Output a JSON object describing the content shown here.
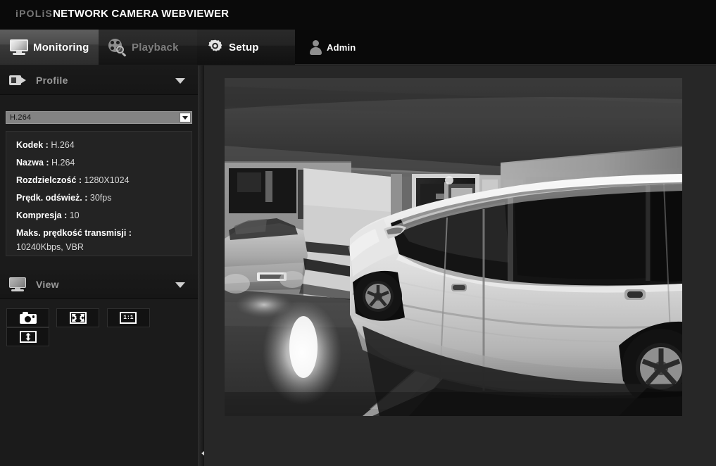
{
  "header": {
    "brand_prefix": "iPOLiS",
    "brand_title": "NETWORK CAMERA WEBVIEWER"
  },
  "tabs": [
    {
      "id": "monitoring",
      "label": "Monitoring",
      "icon": "monitor-icon",
      "active": true
    },
    {
      "id": "playback",
      "label": "Playback",
      "icon": "film-reel-search-icon",
      "active": false
    },
    {
      "id": "setup",
      "label": "Setup",
      "icon": "gear-icon",
      "active": false
    }
  ],
  "user": {
    "label": "Admin",
    "icon": "person-icon"
  },
  "sidebar": {
    "profile_panel": {
      "title": "Profile",
      "icon": "camcorder-icon",
      "chevron": "chevron-down-icon",
      "select": {
        "value": "H.264",
        "button_icon": "chevron-down-icon"
      },
      "info": [
        {
          "key": "Kodek :",
          "value": "H.264"
        },
        {
          "key": "Nazwa :",
          "value": "H.264"
        },
        {
          "key": "Rozdzielczość :",
          "value": "1280X1024"
        },
        {
          "key": "Prędk. odśwież. :",
          "value": "30fps"
        },
        {
          "key": "Kompresja :",
          "value": "10"
        }
      ],
      "info_last_key": "Maks. prędkość transmisji :",
      "info_last_value": "10240Kbps, VBR"
    },
    "view_panel": {
      "title": "View",
      "icon": "monitor-icon",
      "chevron": "chevron-down-icon",
      "buttons": [
        {
          "id": "snapshot",
          "icon": "camera-snapshot-icon",
          "label": ""
        },
        {
          "id": "fullscreen",
          "icon": "fullscreen-expand-icon",
          "label": ""
        },
        {
          "id": "ratio-1-1",
          "icon": "one-to-one-icon",
          "label": "1:1"
        },
        {
          "id": "fit-height",
          "icon": "fit-height-icon",
          "label": ""
        }
      ]
    },
    "collapse_handle_icon": "triangle-left-icon"
  },
  "video": {
    "scene": "parking-garage-night-grayscale",
    "description": "Grayscale CCTV view of an underground parking garage with a white minivan in the foreground, a silver sedan parked at left, glass elevator doors in the middle background and a painted white floor line."
  },
  "colors": {
    "page_bg": "#1c1c1c",
    "header_bg": "#0a0a0a",
    "sidebar_bg": "#1b1b1b",
    "main_bg": "#272727",
    "active_tab": "#4a4a4a",
    "text_primary": "#ffffff",
    "text_muted": "#9a9a9a",
    "select_bg": "#838383"
  }
}
